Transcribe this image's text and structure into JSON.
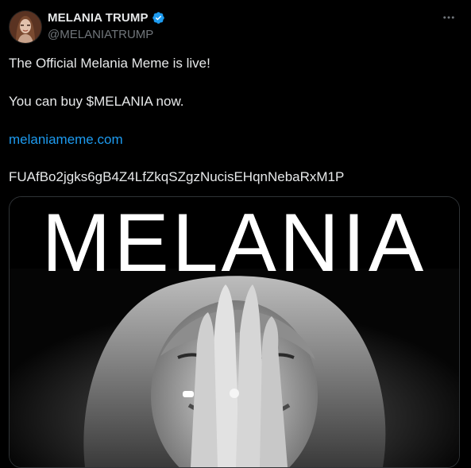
{
  "author": {
    "name": "MELANIA TRUMP",
    "handle": "@MELANIATRUMP",
    "verified": true,
    "avatar_icon": "profile-photo"
  },
  "more_icon": "more-horizontal-icon",
  "tweet": {
    "line1": "The Official Melania Meme is live!",
    "line2": "You can buy $MELANIA now.",
    "link": "melaniameme.com",
    "address": "FUAfBo2jgks6gB4Z4LfZkqSZgzNucisEHqnNebaRxM1P"
  },
  "media": {
    "title": "MELANIA",
    "description_icon": "portrait-photo"
  },
  "colors": {
    "background": "#000000",
    "text": "#e7e9ea",
    "secondary": "#71767b",
    "link": "#1d9bf0",
    "verified": "#1d9bf0"
  }
}
